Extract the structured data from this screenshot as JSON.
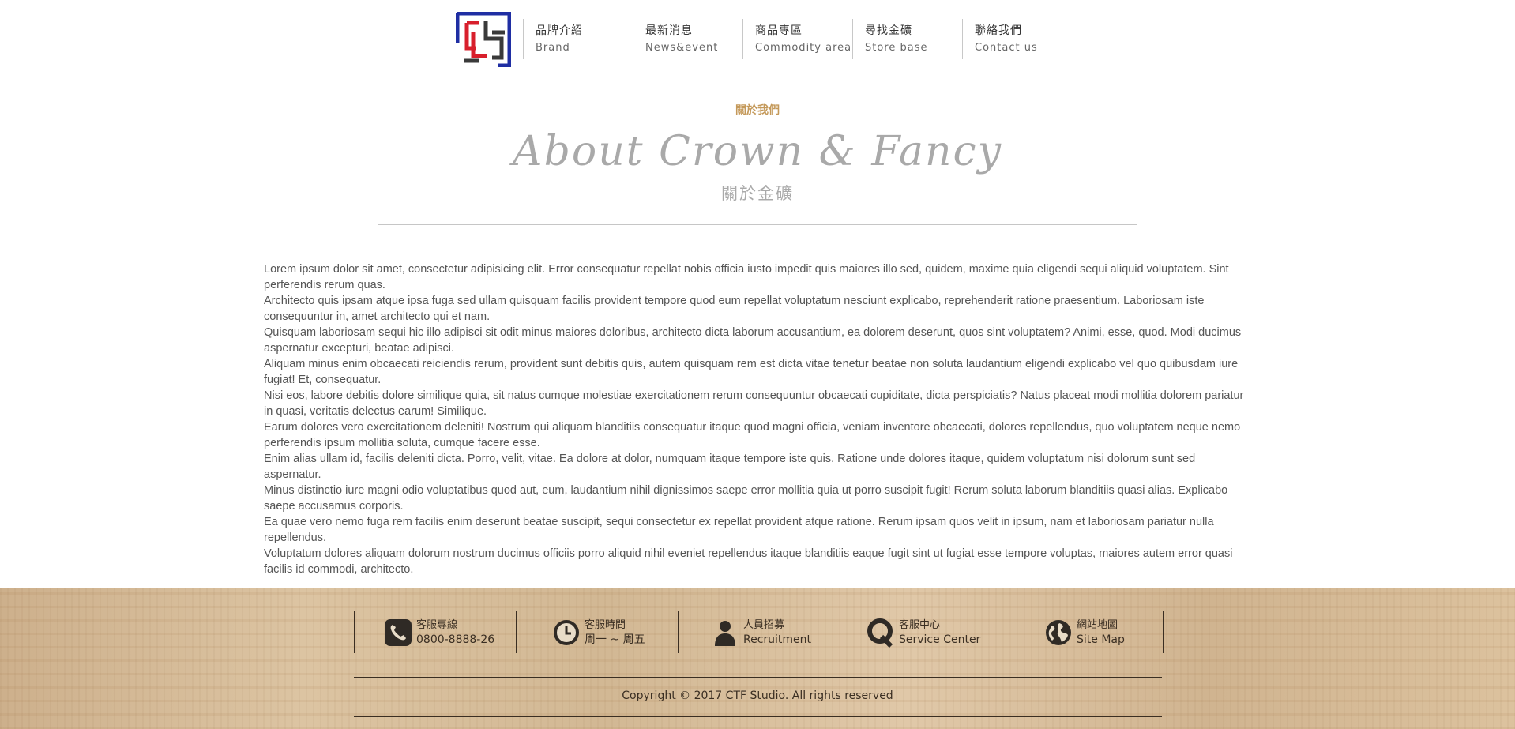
{
  "brand": {
    "logo_icon": "ctf-monogram-logo",
    "colors": {
      "blue": "#1f2ea3",
      "red": "#d81f2c",
      "dark": "#3a3a3a"
    }
  },
  "nav": {
    "items": [
      {
        "zh": "品牌介紹",
        "en": "Brand"
      },
      {
        "zh": "最新消息",
        "en": "News&event"
      },
      {
        "zh": "商品專區",
        "en": "Commodity area"
      },
      {
        "zh": "尋找金礦",
        "en": "Store base"
      },
      {
        "zh": "聯絡我們",
        "en": "Contact us"
      }
    ]
  },
  "about": {
    "eyebrow": "關於我們",
    "title_en": "About Crown & Fancy",
    "title_zh": "關於金礦",
    "accent_color": "#c4995a",
    "paragraphs": [
      "Lorem ipsum dolor sit amet, consectetur adipisicing elit. Error consequatur repellat nobis officia iusto impedit quis maiores illo sed, quidem, maxime quia eligendi sequi aliquid voluptatem. Sint perferendis rerum quas.",
      "Architecto quis ipsam atque ipsa fuga sed ullam quisquam facilis provident tempore quod eum repellat voluptatum nesciunt explicabo, reprehenderit ratione praesentium. Laboriosam iste consequuntur in, amet architecto qui et nam.",
      "Quisquam laboriosam sequi hic illo adipisci sit odit minus maiores doloribus, architecto dicta laborum accusantium, ea dolorem deserunt, quos sint voluptatem? Animi, esse, quod. Modi ducimus aspernatur excepturi, beatae adipisci.",
      "Aliquam minus enim obcaecati reiciendis rerum, provident sunt debitis quis, autem quisquam rem est dicta vitae tenetur beatae non soluta laudantium eligendi explicabo vel quo quibusdam iure fugiat! Et, consequatur.",
      "Nisi eos, labore debitis dolore similique quia, sit natus cumque molestiae exercitationem rerum consequuntur obcaecati cupiditate, dicta perspiciatis? Natus placeat modi mollitia dolorem pariatur in quasi, veritatis delectus earum! Similique.",
      "Earum dolores vero exercitationem deleniti! Nostrum qui aliquam blanditiis consequatur itaque quod magni officia, veniam inventore obcaecati, dolores repellendus, quo voluptatem neque nemo perferendis ipsum mollitia soluta, cumque facere esse.",
      "Enim alias ullam id, facilis deleniti dicta. Porro, velit, vitae. Ea dolore at dolor, numquam itaque tempore iste quis. Ratione unde dolores itaque, quidem voluptatum nisi dolorum sunt sed aspernatur.",
      "Minus distinctio iure magni odio voluptatibus quod aut, eum, laudantium nihil dignissimos saepe error mollitia quia ut porro suscipit fugit! Rerum soluta laborum blanditiis quasi alias. Explicabo saepe accusamus corporis.",
      "Ea quae vero nemo fuga rem facilis enim deserunt beatae suscipit, sequi consectetur ex repellat provident atque ratione. Rerum ipsam quos velit in ipsum, nam et laboriosam pariatur nulla repellendus.",
      "Voluptatum dolores aliquam dolorum nostrum ducimus officiis porro aliquid nihil eveniet repellendus itaque blanditiis eaque fugit sint ut fugiat esse tempore voluptas, maiores autem error quasi facilis id commodi, architecto."
    ]
  },
  "footer": {
    "contacts": [
      {
        "icon": "phone-icon",
        "top": "客服專線",
        "bottom": "0800-8888-26"
      },
      {
        "icon": "clock-icon",
        "top": "客服時間",
        "bottom": "周一 ~ 周五"
      },
      {
        "icon": "person-icon",
        "top": "人員招募",
        "bottom": "Recruitment"
      },
      {
        "icon": "q-icon",
        "top": "客服中心",
        "bottom": "Service Center"
      },
      {
        "icon": "globe-icon",
        "top": "網站地圖",
        "bottom": "Site Map"
      }
    ],
    "copyright": "Copyright © 2017 CTF Studio. All rights reserved",
    "text_color": "#3a2e22"
  }
}
